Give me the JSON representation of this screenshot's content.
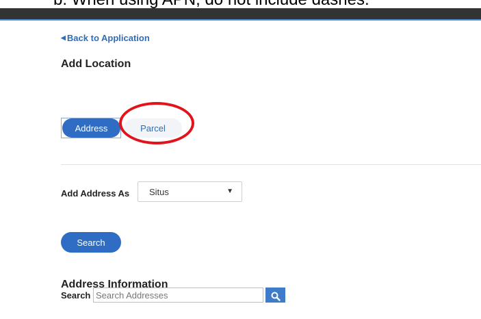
{
  "document_caption": "b.   When using APN, do not include dashes.",
  "nav": {
    "back_link": "Back to Application"
  },
  "page": {
    "title": "Add Location"
  },
  "location_tabs": [
    {
      "label": "Address",
      "selected": true
    },
    {
      "label": "Parcel",
      "selected": false
    }
  ],
  "add_as": {
    "label": "Add Address As",
    "selected_value": "Situs"
  },
  "search_button": {
    "label": "Search"
  },
  "address_info": {
    "title": "Address Information",
    "search_label": "Search",
    "search_placeholder": "Search Addresses"
  },
  "colors": {
    "primary": "#2f6dc4",
    "link": "#2f6db5",
    "annotation": "#e2131b"
  }
}
